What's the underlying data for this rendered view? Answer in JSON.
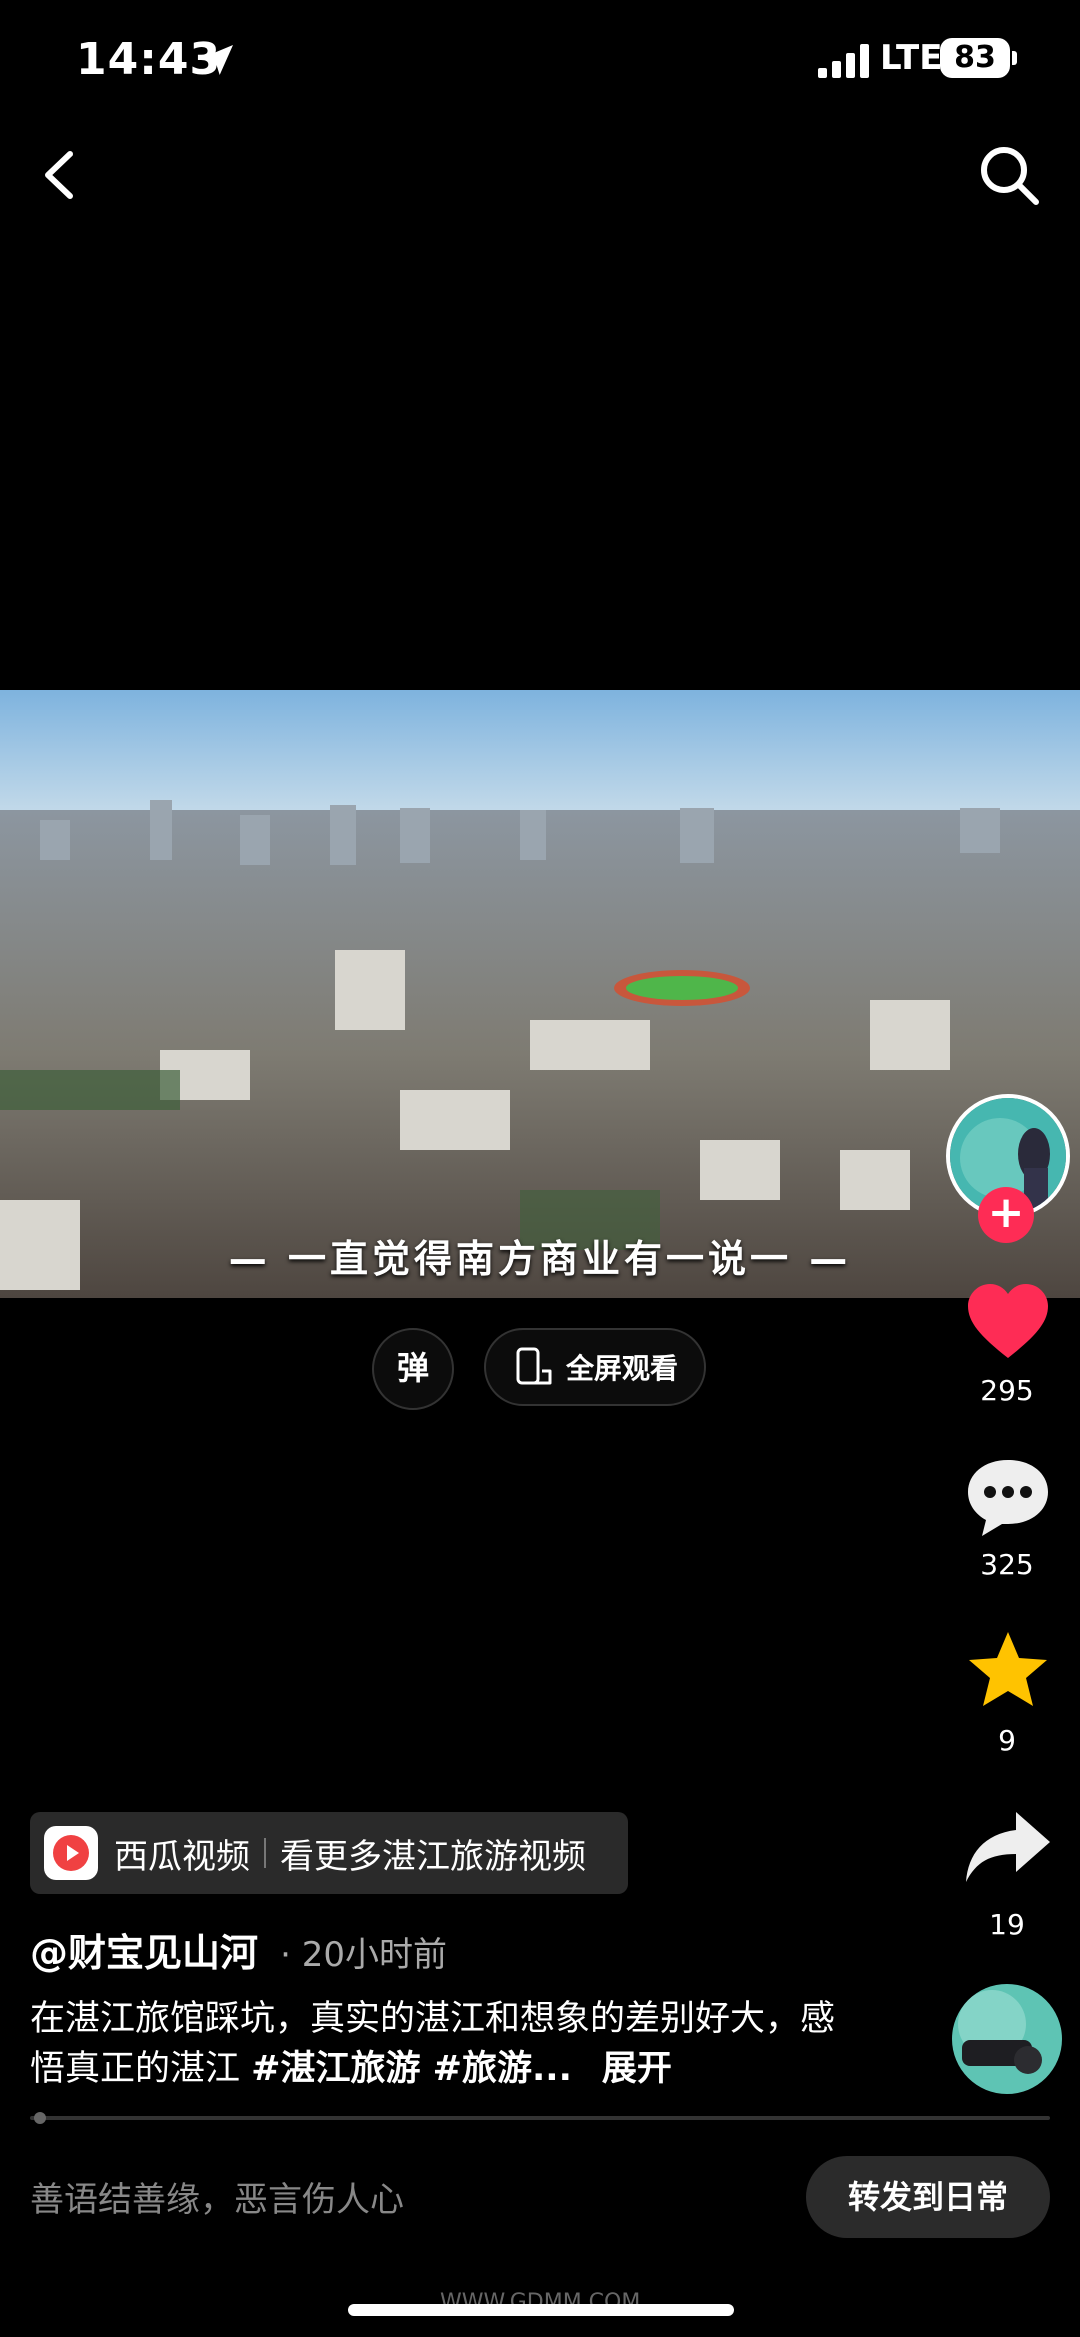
{
  "status_bar": {
    "time": "14:43",
    "network": "LTE",
    "battery": "83"
  },
  "video": {
    "subtitle": "一直觉得南方商业有一说一"
  },
  "controls": {
    "danmu_label": "弹",
    "fullscreen_label": "全屏观看"
  },
  "actions": {
    "likes": "295",
    "comments": "325",
    "favorites": "9",
    "shares": "19",
    "follow_symbol": "+"
  },
  "banner": {
    "app": "西瓜视频",
    "cta": "看更多湛江旅游视频"
  },
  "post": {
    "author": "@财宝见山河",
    "time": "· 20小时前",
    "caption": "在湛江旅馆踩坑，真实的湛江和想象的差别好大，感悟真正的湛江 ",
    "hashtags": "#湛江旅游 #旅游...",
    "expand": "展开"
  },
  "bottom": {
    "comment_placeholder": "善语结善缘，恶言伤人心",
    "repost_label": "转发到日常"
  },
  "watermark": "WWW.GDMM.COM",
  "colors": {
    "like": "#fe2c55",
    "favorite": "#ffc300",
    "follow": "#fe2c55"
  }
}
